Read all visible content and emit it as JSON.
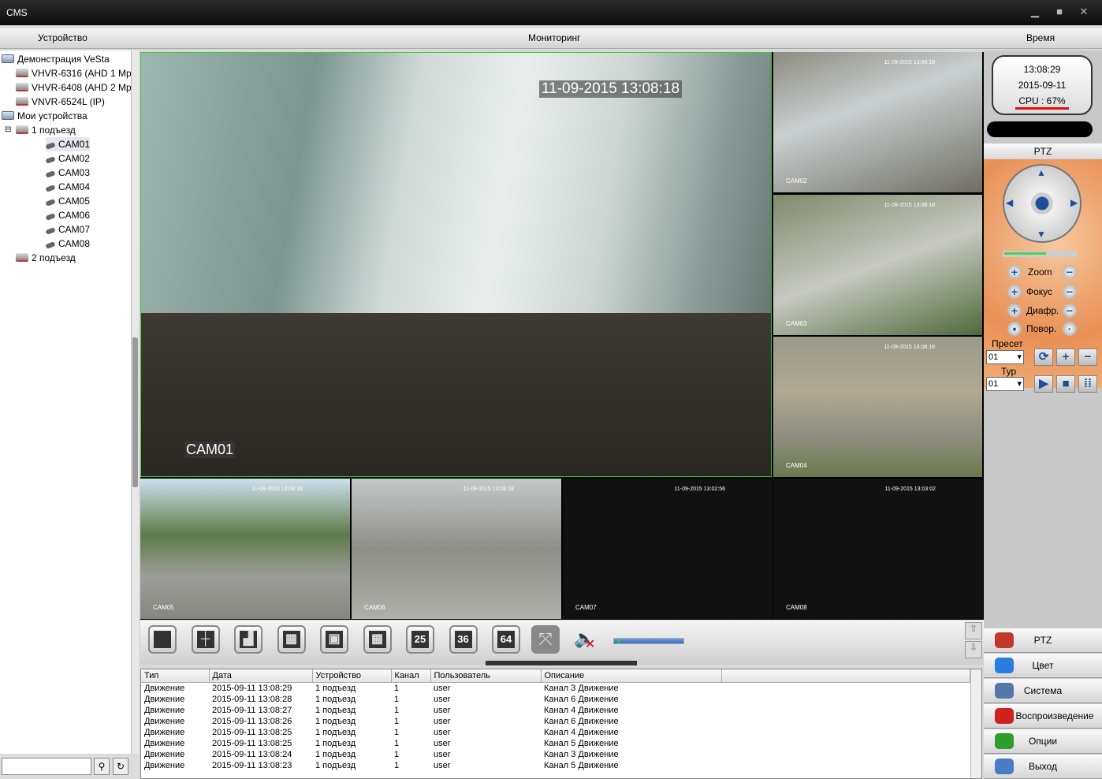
{
  "window": {
    "title": "CMS"
  },
  "menu": {
    "device": "Устройство",
    "monitoring": "Мониторинг",
    "time": "Время"
  },
  "tree": [
    {
      "label": "Демонстрация VeSta",
      "icon": "folder",
      "level": 0
    },
    {
      "label": "VHVR-6316 (AHD 1 Mp",
      "icon": "dvr",
      "level": 1
    },
    {
      "label": "VHVR-6408 (AHD 2 Mp",
      "icon": "dvr",
      "level": 1
    },
    {
      "label": "VNVR-6524L (IP)",
      "icon": "dvr",
      "level": 1
    },
    {
      "label": "Мои устройства",
      "icon": "folder",
      "level": 0
    },
    {
      "label": "1 подъезд",
      "icon": "dvr",
      "level": 1,
      "expanded": true
    },
    {
      "label": "CAM01",
      "icon": "camera",
      "level": 2,
      "selected": true
    },
    {
      "label": "CAM02",
      "icon": "camera",
      "level": 2
    },
    {
      "label": "CAM03",
      "icon": "camera",
      "level": 2
    },
    {
      "label": "CAM04",
      "icon": "camera",
      "level": 2
    },
    {
      "label": "CAM05",
      "icon": "camera",
      "level": 2
    },
    {
      "label": "CAM06",
      "icon": "camera",
      "level": 2
    },
    {
      "label": "CAM07",
      "icon": "camera",
      "level": 2
    },
    {
      "label": "CAM08",
      "icon": "camera",
      "level": 2
    },
    {
      "label": "2 подъезд",
      "icon": "dvr",
      "level": 1
    }
  ],
  "video": {
    "main": {
      "label": "CAM01",
      "timestamp": "11-09-2015 13:08:18"
    },
    "tiles": [
      {
        "label": "CAM02",
        "timestamp": "11-09-2015 13:08:18"
      },
      {
        "label": "CAM03",
        "timestamp": "11-09-2015 13:08:18"
      },
      {
        "label": "CAM04",
        "timestamp": "11-09-2015 13:08:18"
      },
      {
        "label": "CAM05",
        "timestamp": "11-09-2015 13:08:18"
      },
      {
        "label": "CAM06",
        "timestamp": "11-09-2015 13:08:18"
      },
      {
        "label": "CAM07",
        "timestamp": "11-09-2015 13:02:56"
      },
      {
        "label": "CAM08",
        "timestamp": "11-09-2015 13:03:02"
      }
    ]
  },
  "toolbar": {
    "layouts": [
      "1",
      "4",
      "6",
      "8",
      "9",
      "16",
      "25",
      "36",
      "64"
    ],
    "volume": 0.05
  },
  "events": {
    "columns": [
      "Тип",
      "Дата",
      "Устройство",
      "Канал",
      "Пользователь",
      "Описание"
    ],
    "rows": [
      [
        "Движение",
        "2015-09-11 13:08:29",
        "1 подъезд",
        "1",
        "user",
        "Канал 3 Движение"
      ],
      [
        "Движение",
        "2015-09-11 13:08:28",
        "1 подъезд",
        "1",
        "user",
        "Канал 6 Движение"
      ],
      [
        "Движение",
        "2015-09-11 13:08:27",
        "1 подъезд",
        "1",
        "user",
        "Канал 4 Движение"
      ],
      [
        "Движение",
        "2015-09-11 13:08:26",
        "1 подъезд",
        "1",
        "user",
        "Канал 6 Движение"
      ],
      [
        "Движение",
        "2015-09-11 13:08:25",
        "1 подъезд",
        "1",
        "user",
        "Канал 4 Движение"
      ],
      [
        "Движение",
        "2015-09-11 13:08:25",
        "1 подъезд",
        "1",
        "user",
        "Канал 5 Движение"
      ],
      [
        "Движение",
        "2015-09-11 13:08:24",
        "1 подъезд",
        "1",
        "user",
        "Канал 3 Движение"
      ],
      [
        "Движение",
        "2015-09-11 13:08:23",
        "1 подъезд",
        "1",
        "user",
        "Канал 5 Движение"
      ]
    ]
  },
  "status": {
    "time": "13:08:29",
    "date": "2015-09-11",
    "cpu": "CPU : 67%"
  },
  "ptz": {
    "title": "PTZ",
    "zoom": "Zoom",
    "focus": "Фокус",
    "iris": "Диафр.",
    "rotate": "Повор.",
    "preset_label": "Пресет",
    "preset_value": "01",
    "tour_label": "Тур",
    "tour_value": "01",
    "speed": 0.6
  },
  "nav": [
    {
      "label": "PTZ",
      "color": "#c0392b"
    },
    {
      "label": "Цвет",
      "color": "#2a7de1"
    },
    {
      "label": "Система",
      "color": "#5577aa"
    },
    {
      "label": "Воспроизведение",
      "color": "#d02020"
    },
    {
      "label": "Опции",
      "color": "#2e9e2e"
    },
    {
      "label": "Выход",
      "color": "#4a7bc4"
    }
  ]
}
